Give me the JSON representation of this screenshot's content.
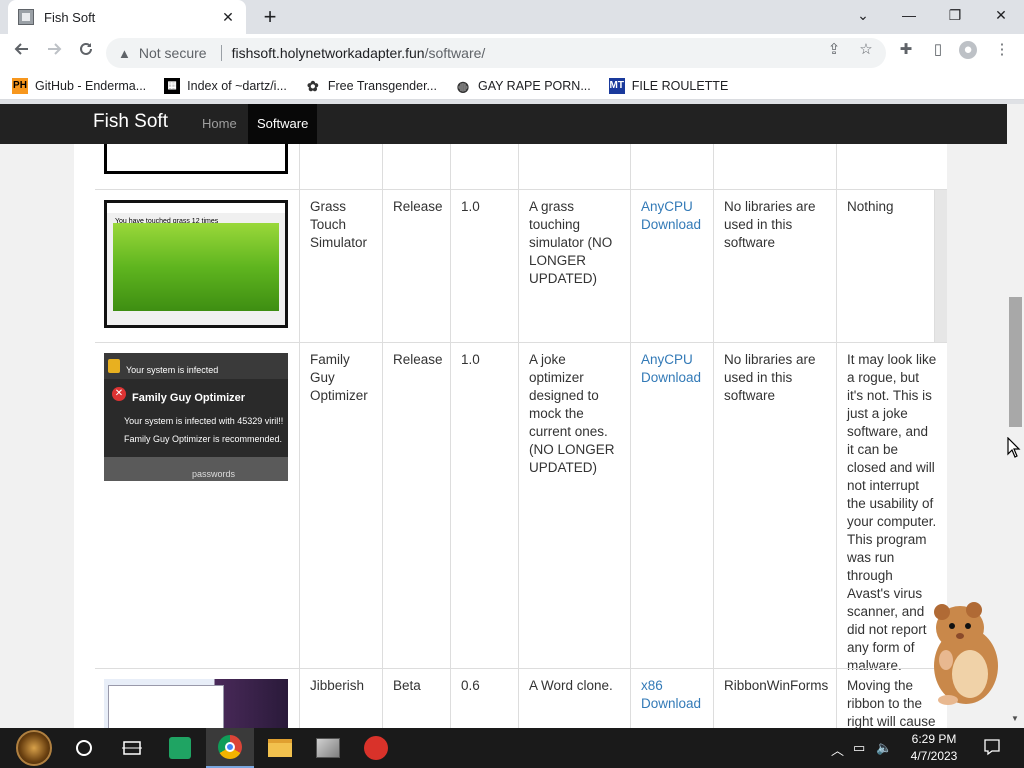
{
  "browser": {
    "tab_title": "Fish Soft",
    "tab_close": "✕",
    "new_tab": "+",
    "security_label": "Not secure",
    "url_host": "fishsoft.holynetworkadapter.fun",
    "url_path": "/software/",
    "window_controls": {
      "chevron": "⌄",
      "minimize": "—",
      "restore": "❐",
      "close": "✕"
    }
  },
  "bookmarks": [
    {
      "label": "GitHub - Enderma...",
      "icon": "pornhub-icon",
      "glyph": "PH"
    },
    {
      "label": "Index of ~dartz/i...",
      "icon": "qr-icon",
      "glyph": "▦"
    },
    {
      "label": "Free Transgender...",
      "icon": "sticker-icon",
      "glyph": "✿"
    },
    {
      "label": "GAY RAPE PORN...",
      "icon": "globe-icon",
      "glyph": "◍"
    },
    {
      "label": "FILE ROULETTE",
      "icon": "mt-icon",
      "glyph": "MT"
    }
  ],
  "site": {
    "brand": "Fish Soft",
    "nav": {
      "home": "Home",
      "software": "Software"
    }
  },
  "table": {
    "rows": [
      {
        "name": "Grass Touch Simulator",
        "status": "Release",
        "version": "1.0",
        "description": "A grass touching simulator (NO LONGER UPDATED)",
        "download_arch": "AnyCPU",
        "download_label": "Download",
        "libraries": "No libraries are used in this software",
        "notes": "Nothing",
        "thumb_caption": "You have touched grass 12 times"
      },
      {
        "name": "Family Guy Optimizer",
        "status": "Release",
        "version": "1.0",
        "description": "A joke optimizer designed to mock the current ones. (NO LONGER UPDATED)",
        "download_arch": "AnyCPU",
        "download_label": "Download",
        "libraries": "No libraries are used in this software",
        "notes": "It may look like a rogue, but it's not. This is just a joke software, and it can be closed and will not interrupt the usability of your computer. This program was run through Avast's virus scanner, and did not report any form of malware.",
        "thumb_title": "Family Guy Optimizer",
        "thumb_top": "Your system is infected",
        "thumb_line1": "Your system is infected with 45329 viril!!",
        "thumb_line2": "Family Guy Optimizer is recommended.",
        "thumb_footer": "passwords"
      },
      {
        "name": "Jibberish",
        "status": "Beta",
        "version": "0.6",
        "description": "A Word clone.",
        "download_arch": "x86",
        "download_label": "Download",
        "libraries": "RibbonWinForms",
        "notes": "Moving the ribbon to the right will cause"
      }
    ]
  },
  "taskbar": {
    "time": "6:29 PM",
    "date": "4/7/2023"
  },
  "colors": {
    "navbar": "#222222",
    "link": "#337ab7"
  }
}
